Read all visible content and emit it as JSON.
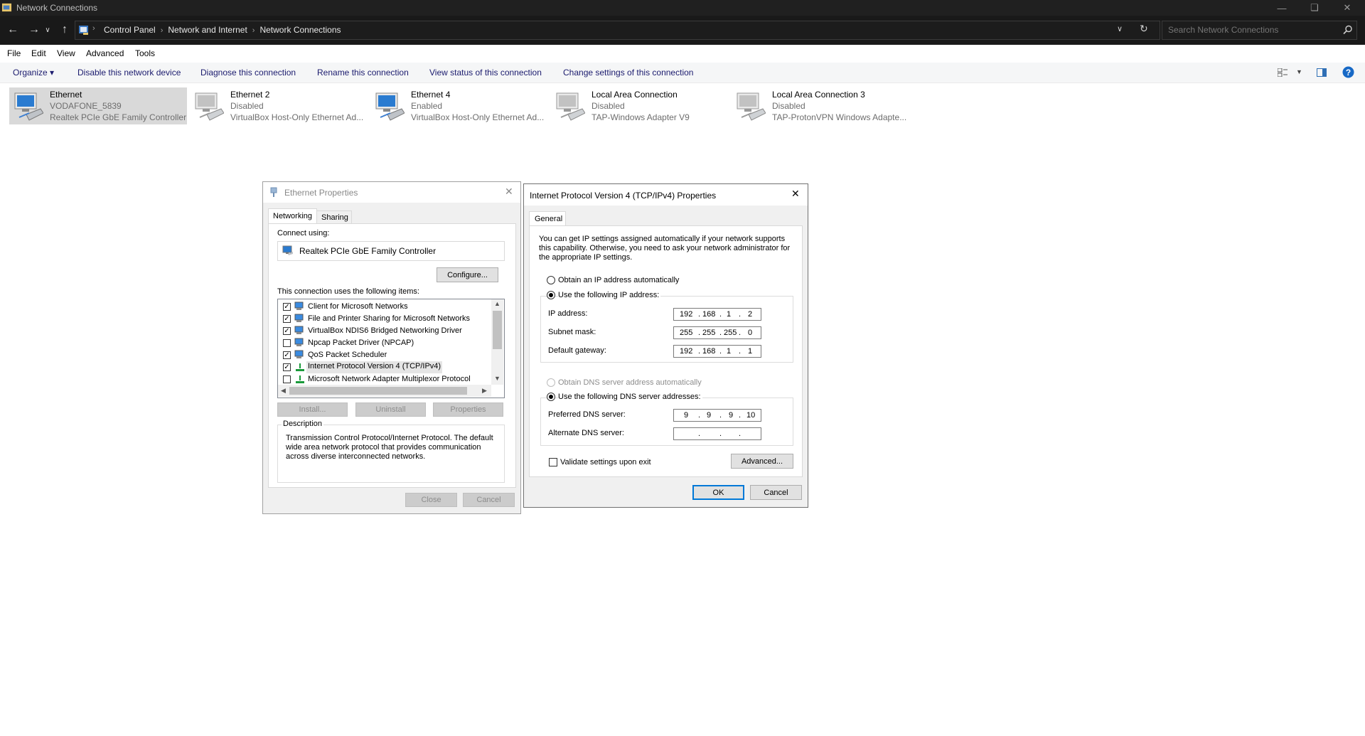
{
  "window": {
    "title": "Network Connections"
  },
  "address": {
    "crumbs": [
      "Control Panel",
      "Network and Internet",
      "Network Connections"
    ],
    "search_placeholder": "Search Network Connections"
  },
  "menu": [
    "File",
    "Edit",
    "View",
    "Advanced",
    "Tools"
  ],
  "commands": [
    "Organize ▾",
    "Disable this network device",
    "Diagnose this connection",
    "Rename this connection",
    "View status of this connection",
    "Change settings of this connection"
  ],
  "connections": [
    {
      "name": "Ethernet",
      "status": "VODAFONE_5839",
      "device": "Realtek PCIe GbE Family Controller",
      "selected": true
    },
    {
      "name": "Ethernet 2",
      "status": "Disabled",
      "device": "VirtualBox Host-Only Ethernet Ad...",
      "selected": false
    },
    {
      "name": "Ethernet 4",
      "status": "Enabled",
      "device": "VirtualBox Host-Only Ethernet Ad...",
      "selected": false
    },
    {
      "name": "Local Area Connection",
      "status": "Disabled",
      "device": "TAP-Windows Adapter V9",
      "selected": false
    },
    {
      "name": "Local Area Connection 3",
      "status": "Disabled",
      "device": "TAP-ProtonVPN Windows Adapte...",
      "selected": false
    }
  ],
  "eth_dialog": {
    "title": "Ethernet Properties",
    "tabs": [
      "Networking",
      "Sharing"
    ],
    "connect_using_label": "Connect using:",
    "adapter": "Realtek PCIe GbE Family Controller",
    "configure": "Configure...",
    "items_label": "This connection uses the following items:",
    "items": [
      {
        "label": "Client for Microsoft Networks",
        "checked": true
      },
      {
        "label": "File and Printer Sharing for Microsoft Networks",
        "checked": true
      },
      {
        "label": "VirtualBox NDIS6 Bridged Networking Driver",
        "checked": true
      },
      {
        "label": "Npcap Packet Driver (NPCAP)",
        "checked": false
      },
      {
        "label": "QoS Packet Scheduler",
        "checked": true
      },
      {
        "label": "Internet Protocol Version 4 (TCP/IPv4)",
        "checked": true
      },
      {
        "label": "Microsoft Network Adapter Multiplexor Protocol",
        "checked": false
      }
    ],
    "install": "Install...",
    "uninstall": "Uninstall",
    "properties": "Properties",
    "description_label": "Description",
    "description": "Transmission Control Protocol/Internet Protocol. The default wide area network protocol that provides communication across diverse interconnected networks.",
    "close": "Close",
    "cancel": "Cancel"
  },
  "ipv4_dialog": {
    "title": "Internet Protocol Version 4 (TCP/IPv4) Properties",
    "tab": "General",
    "intro": "You can get IP settings assigned automatically if your network supports this capability. Otherwise, you need to ask your network administrator for the appropriate IP settings.",
    "auto_ip": "Obtain an IP address automatically",
    "manual_ip": "Use the following IP address:",
    "ip_label": "IP address:",
    "ip": [
      "192",
      "168",
      "1",
      "2"
    ],
    "mask_label": "Subnet mask:",
    "mask": [
      "255",
      "255",
      "255",
      "0"
    ],
    "gateway_label": "Default gateway:",
    "gateway": [
      "192",
      "168",
      "1",
      "1"
    ],
    "auto_dns": "Obtain DNS server address automatically",
    "manual_dns": "Use the following DNS server addresses:",
    "pref_dns_label": "Preferred DNS server:",
    "pref_dns": [
      "9",
      "9",
      "9",
      "10"
    ],
    "alt_dns_label": "Alternate DNS server:",
    "alt_dns": [
      "",
      "",
      "",
      ""
    ],
    "validate": "Validate settings upon exit",
    "advanced": "Advanced...",
    "ok": "OK",
    "cancel": "Cancel"
  }
}
